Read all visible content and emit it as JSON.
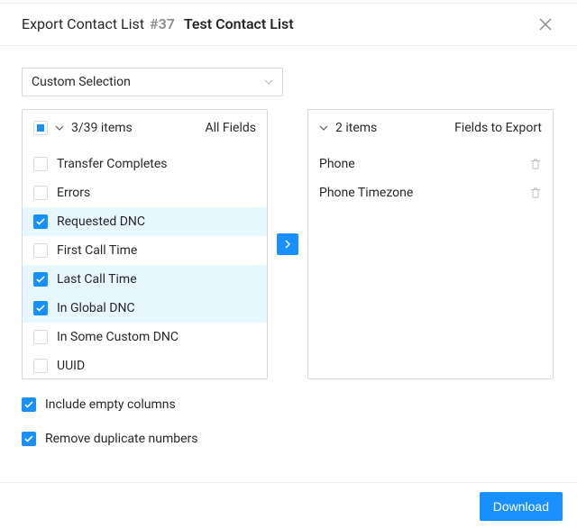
{
  "header": {
    "titlePrefix": "Export Contact List",
    "listNumber": "#37",
    "listName": "Test Contact List"
  },
  "dropdown": {
    "selected": "Custom Selection"
  },
  "leftPanel": {
    "count": "3/39 items",
    "title": "All Fields",
    "items": [
      {
        "label": "Transfer Completes",
        "checked": false
      },
      {
        "label": "Errors",
        "checked": false
      },
      {
        "label": "Requested DNC",
        "checked": true
      },
      {
        "label": "First Call Time",
        "checked": false
      },
      {
        "label": "Last Call Time",
        "checked": true
      },
      {
        "label": "In Global DNC",
        "checked": true
      },
      {
        "label": "In Some Custom DNC",
        "checked": false
      },
      {
        "label": "UUID",
        "checked": false
      }
    ]
  },
  "rightPanel": {
    "count": "2 items",
    "title": "Fields to Export",
    "items": [
      {
        "label": "Phone"
      },
      {
        "label": "Phone Timezone"
      }
    ]
  },
  "options": {
    "includeEmpty": {
      "label": "Include empty columns",
      "checked": true
    },
    "removeDup": {
      "label": "Remove duplicate numbers",
      "checked": true
    }
  },
  "footer": {
    "download": "Download"
  }
}
